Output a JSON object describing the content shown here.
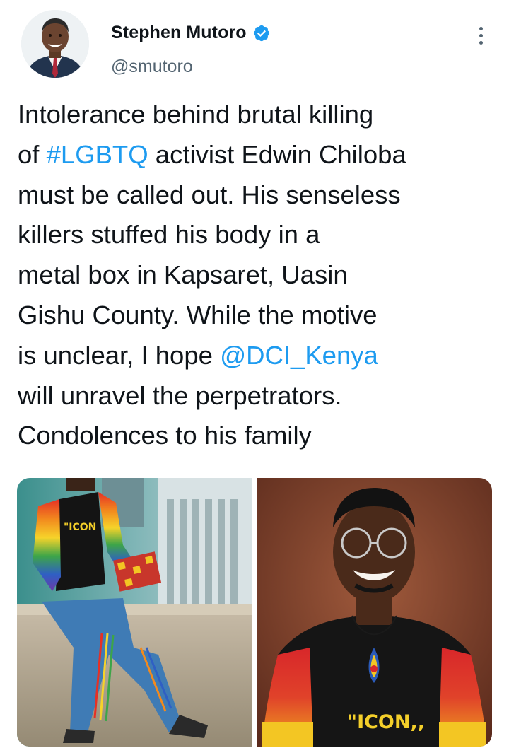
{
  "author": {
    "display_name": "Stephen Mutoro",
    "handle": "@smutoro",
    "verified": true,
    "avatar_icon": "profile-photo"
  },
  "menu": {
    "icon": "more-vertical-icon"
  },
  "tweet": {
    "lines": [
      [
        {
          "text": "Intolerance behind brutal killing"
        }
      ],
      [
        {
          "text": "of "
        },
        {
          "text": "#LGBTQ",
          "link": true
        },
        {
          "text": " activist Edwin Chiloba"
        }
      ],
      [
        {
          "text": "must be called out. His senseless"
        }
      ],
      [
        {
          "text": "killers stuffed his body in a"
        }
      ],
      [
        {
          "text": "metal box in Kapsaret, Uasin"
        }
      ],
      [
        {
          "text": "Gishu County. While the motive"
        }
      ],
      [
        {
          "text": "is unclear, I hope "
        },
        {
          "text": "@DCI_Kenya",
          "link": true
        }
      ],
      [
        {
          "text": "will unravel the perpetrators."
        }
      ],
      [
        {
          "text": "Condolences to his family"
        }
      ]
    ]
  },
  "media": {
    "left_shirt_text": "\"ICON",
    "right_shirt_text": "\"ICON,,"
  },
  "colors": {
    "link": "#1d9bf0",
    "text": "#0f1419",
    "secondary": "#536471",
    "verified": "#1d9bf0"
  }
}
